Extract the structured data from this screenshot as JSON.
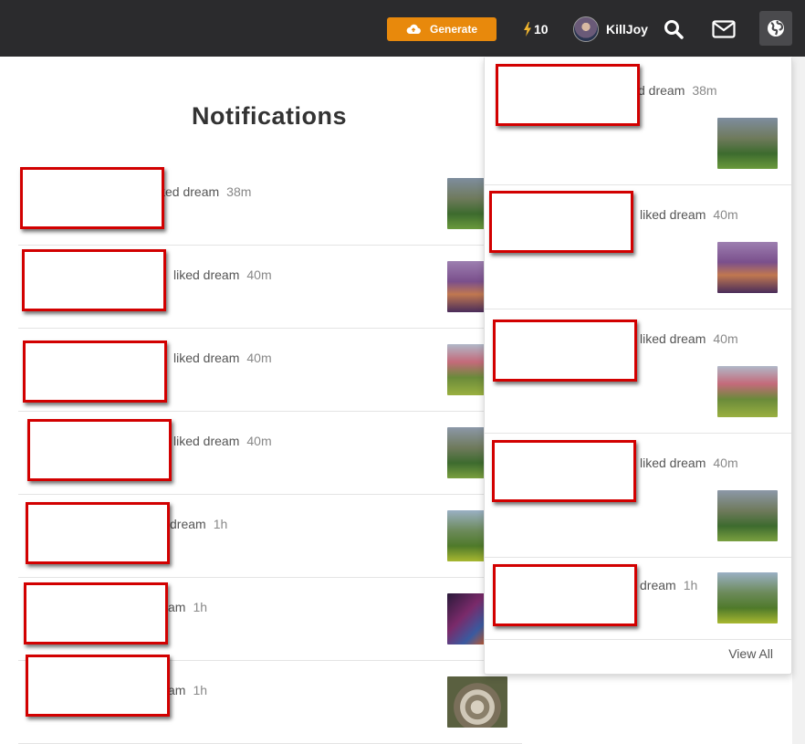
{
  "topbar": {
    "generate_label": "Generate",
    "credits": "10",
    "username": "KillJoy",
    "icons": {
      "generate": "cloud-upload-icon",
      "credits": "lightning-icon",
      "search": "search-icon",
      "mail": "mail-icon",
      "globe": "globe-icon"
    }
  },
  "page": {
    "title": "Notifications",
    "notifications": [
      {
        "text": "ked dream",
        "time": "38m",
        "thumb": "forest-thumb"
      },
      {
        "text": "liked dream",
        "time": "40m",
        "thumb": "purple-trees-thumb"
      },
      {
        "text": "liked dream",
        "time": "40m",
        "thumb": "pink-forest-thumb"
      },
      {
        "text": "liked dream",
        "time": "40m",
        "thumb": "forest-thumb"
      },
      {
        "text": "dream",
        "time": "1h",
        "thumb": "green-forest-thumb"
      },
      {
        "text": "am",
        "time": "1h",
        "thumb": "dark-purple-thumb"
      },
      {
        "text": "am",
        "time": "1h",
        "thumb": "stone-circle-thumb"
      }
    ]
  },
  "dropdown": {
    "items": [
      {
        "text": "d dream",
        "time": "38m",
        "thumb": "forest-thumb"
      },
      {
        "text": "liked dream",
        "time": "40m",
        "thumb": "purple-trees-thumb"
      },
      {
        "text": "liked dream",
        "time": "40m",
        "thumb": "pink-forest-thumb"
      },
      {
        "text": "liked dream",
        "time": "40m",
        "thumb": "forest-thumb"
      },
      {
        "text": "dream",
        "time": "1h",
        "thumb": "green-forest-thumb"
      }
    ],
    "view_all": "View All"
  },
  "colors": {
    "topbar": "#2b2b2d",
    "accent": "#e8890c",
    "redaction": "#d20000"
  }
}
